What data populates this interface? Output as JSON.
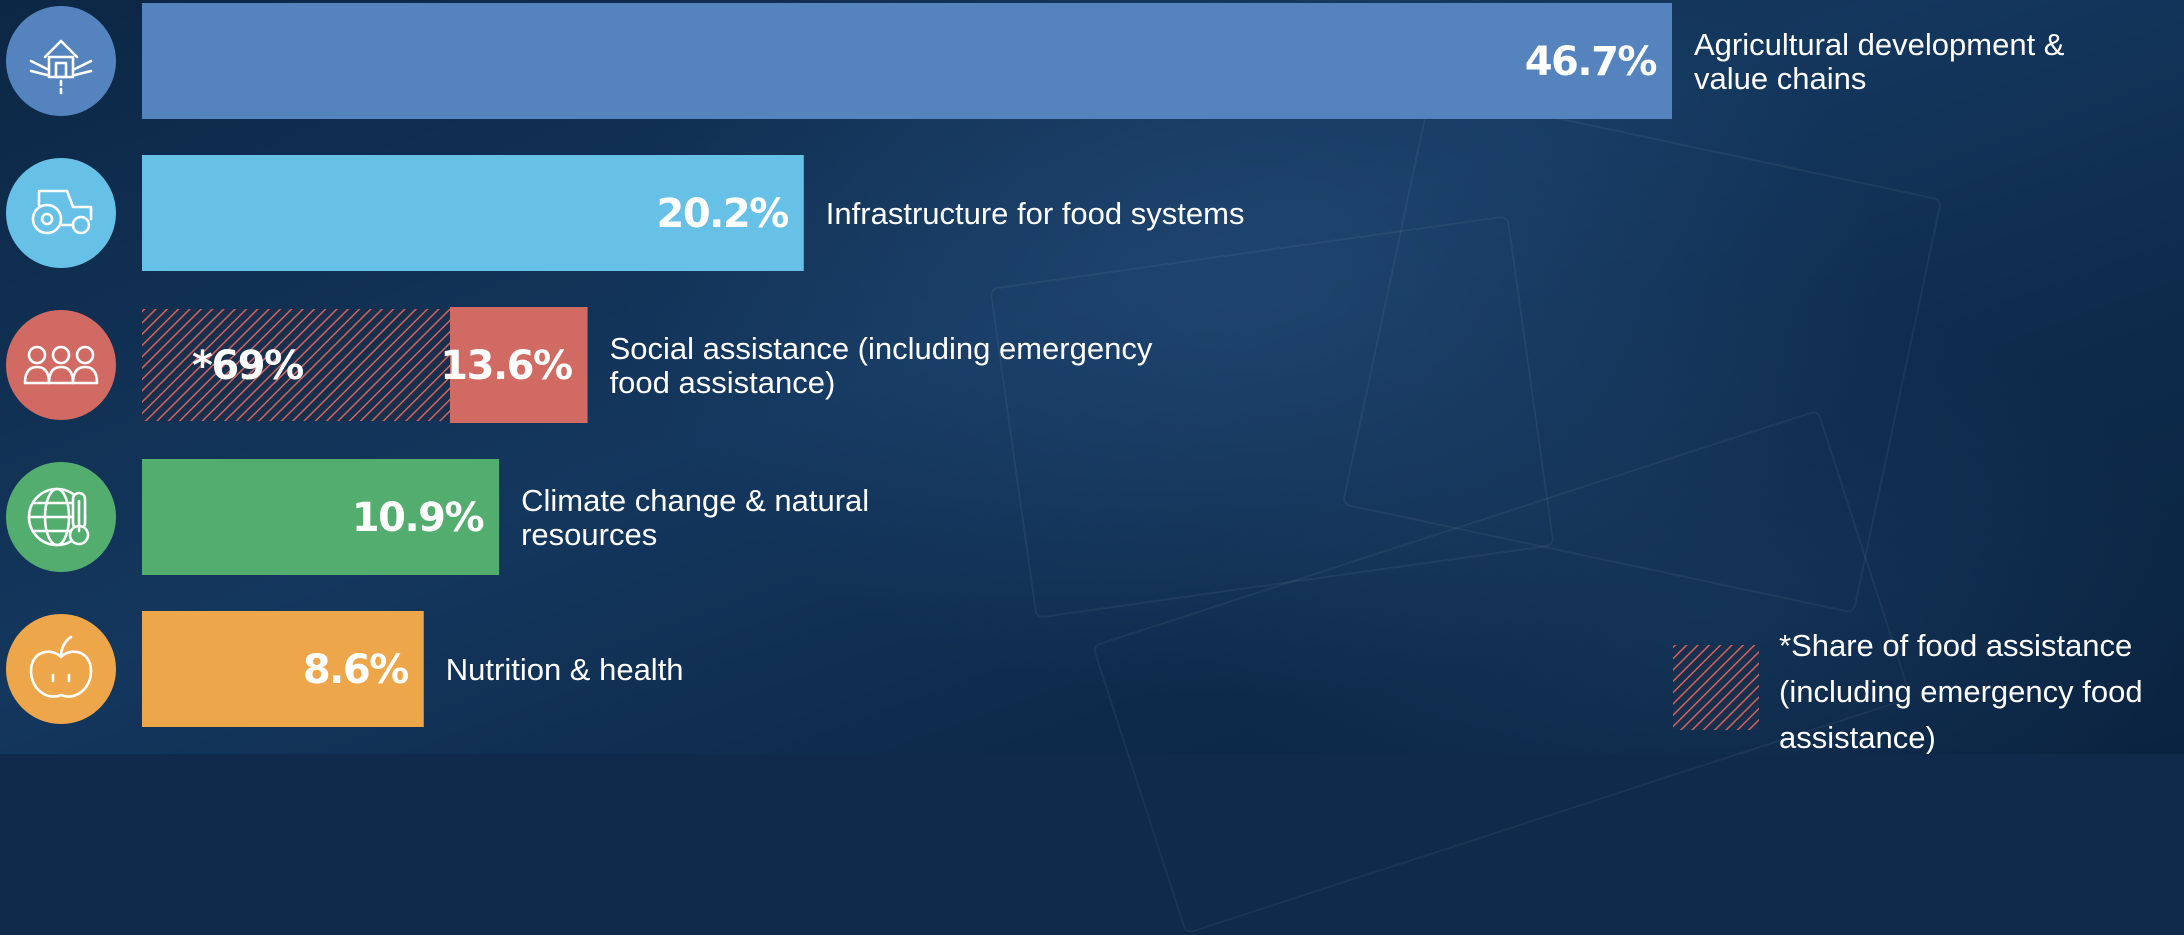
{
  "chart_data": {
    "type": "bar",
    "orientation": "horizontal",
    "categories": [
      "Agricultural development & value chains",
      "Infrastructure for food systems",
      "Social assistance (including emergency food assistance)",
      "Climate change & natural resources",
      "Nutrition & health"
    ],
    "values": [
      46.7,
      20.2,
      13.6,
      10.9,
      8.6
    ],
    "value_labels": [
      "46.7%",
      "20.2%",
      "13.6%",
      "10.9%",
      "8.6%"
    ],
    "label_lines": [
      [
        "Agricultural development &",
        "value chains"
      ],
      [
        "Infrastructure for food systems"
      ],
      [
        "Social assistance (including emergency",
        "food assistance)"
      ],
      [
        "Climate change & natural",
        "resources"
      ],
      [
        "Nutrition & health"
      ]
    ],
    "colors": [
      "#5483be",
      "#67c0e6",
      "#d06a63",
      "#53ad6f",
      "#eea64b"
    ],
    "icons": [
      "farm-barn-icon",
      "tractor-icon",
      "people-group-icon",
      "globe-thermometer-icon",
      "apple-icon"
    ],
    "sub_share": {
      "category": "Social assistance (including emergency food assistance)",
      "value": 69,
      "unit": "% of category",
      "label": "*69%",
      "pattern": "diagonal-hatch"
    },
    "legend": {
      "position": "bottom-right",
      "pattern": "diagonal-hatch",
      "lines": [
        "*Share of food assistance",
        "(including emergency food",
        "assistance)"
      ]
    },
    "xlim": [
      0,
      46.7
    ],
    "grid": false
  }
}
